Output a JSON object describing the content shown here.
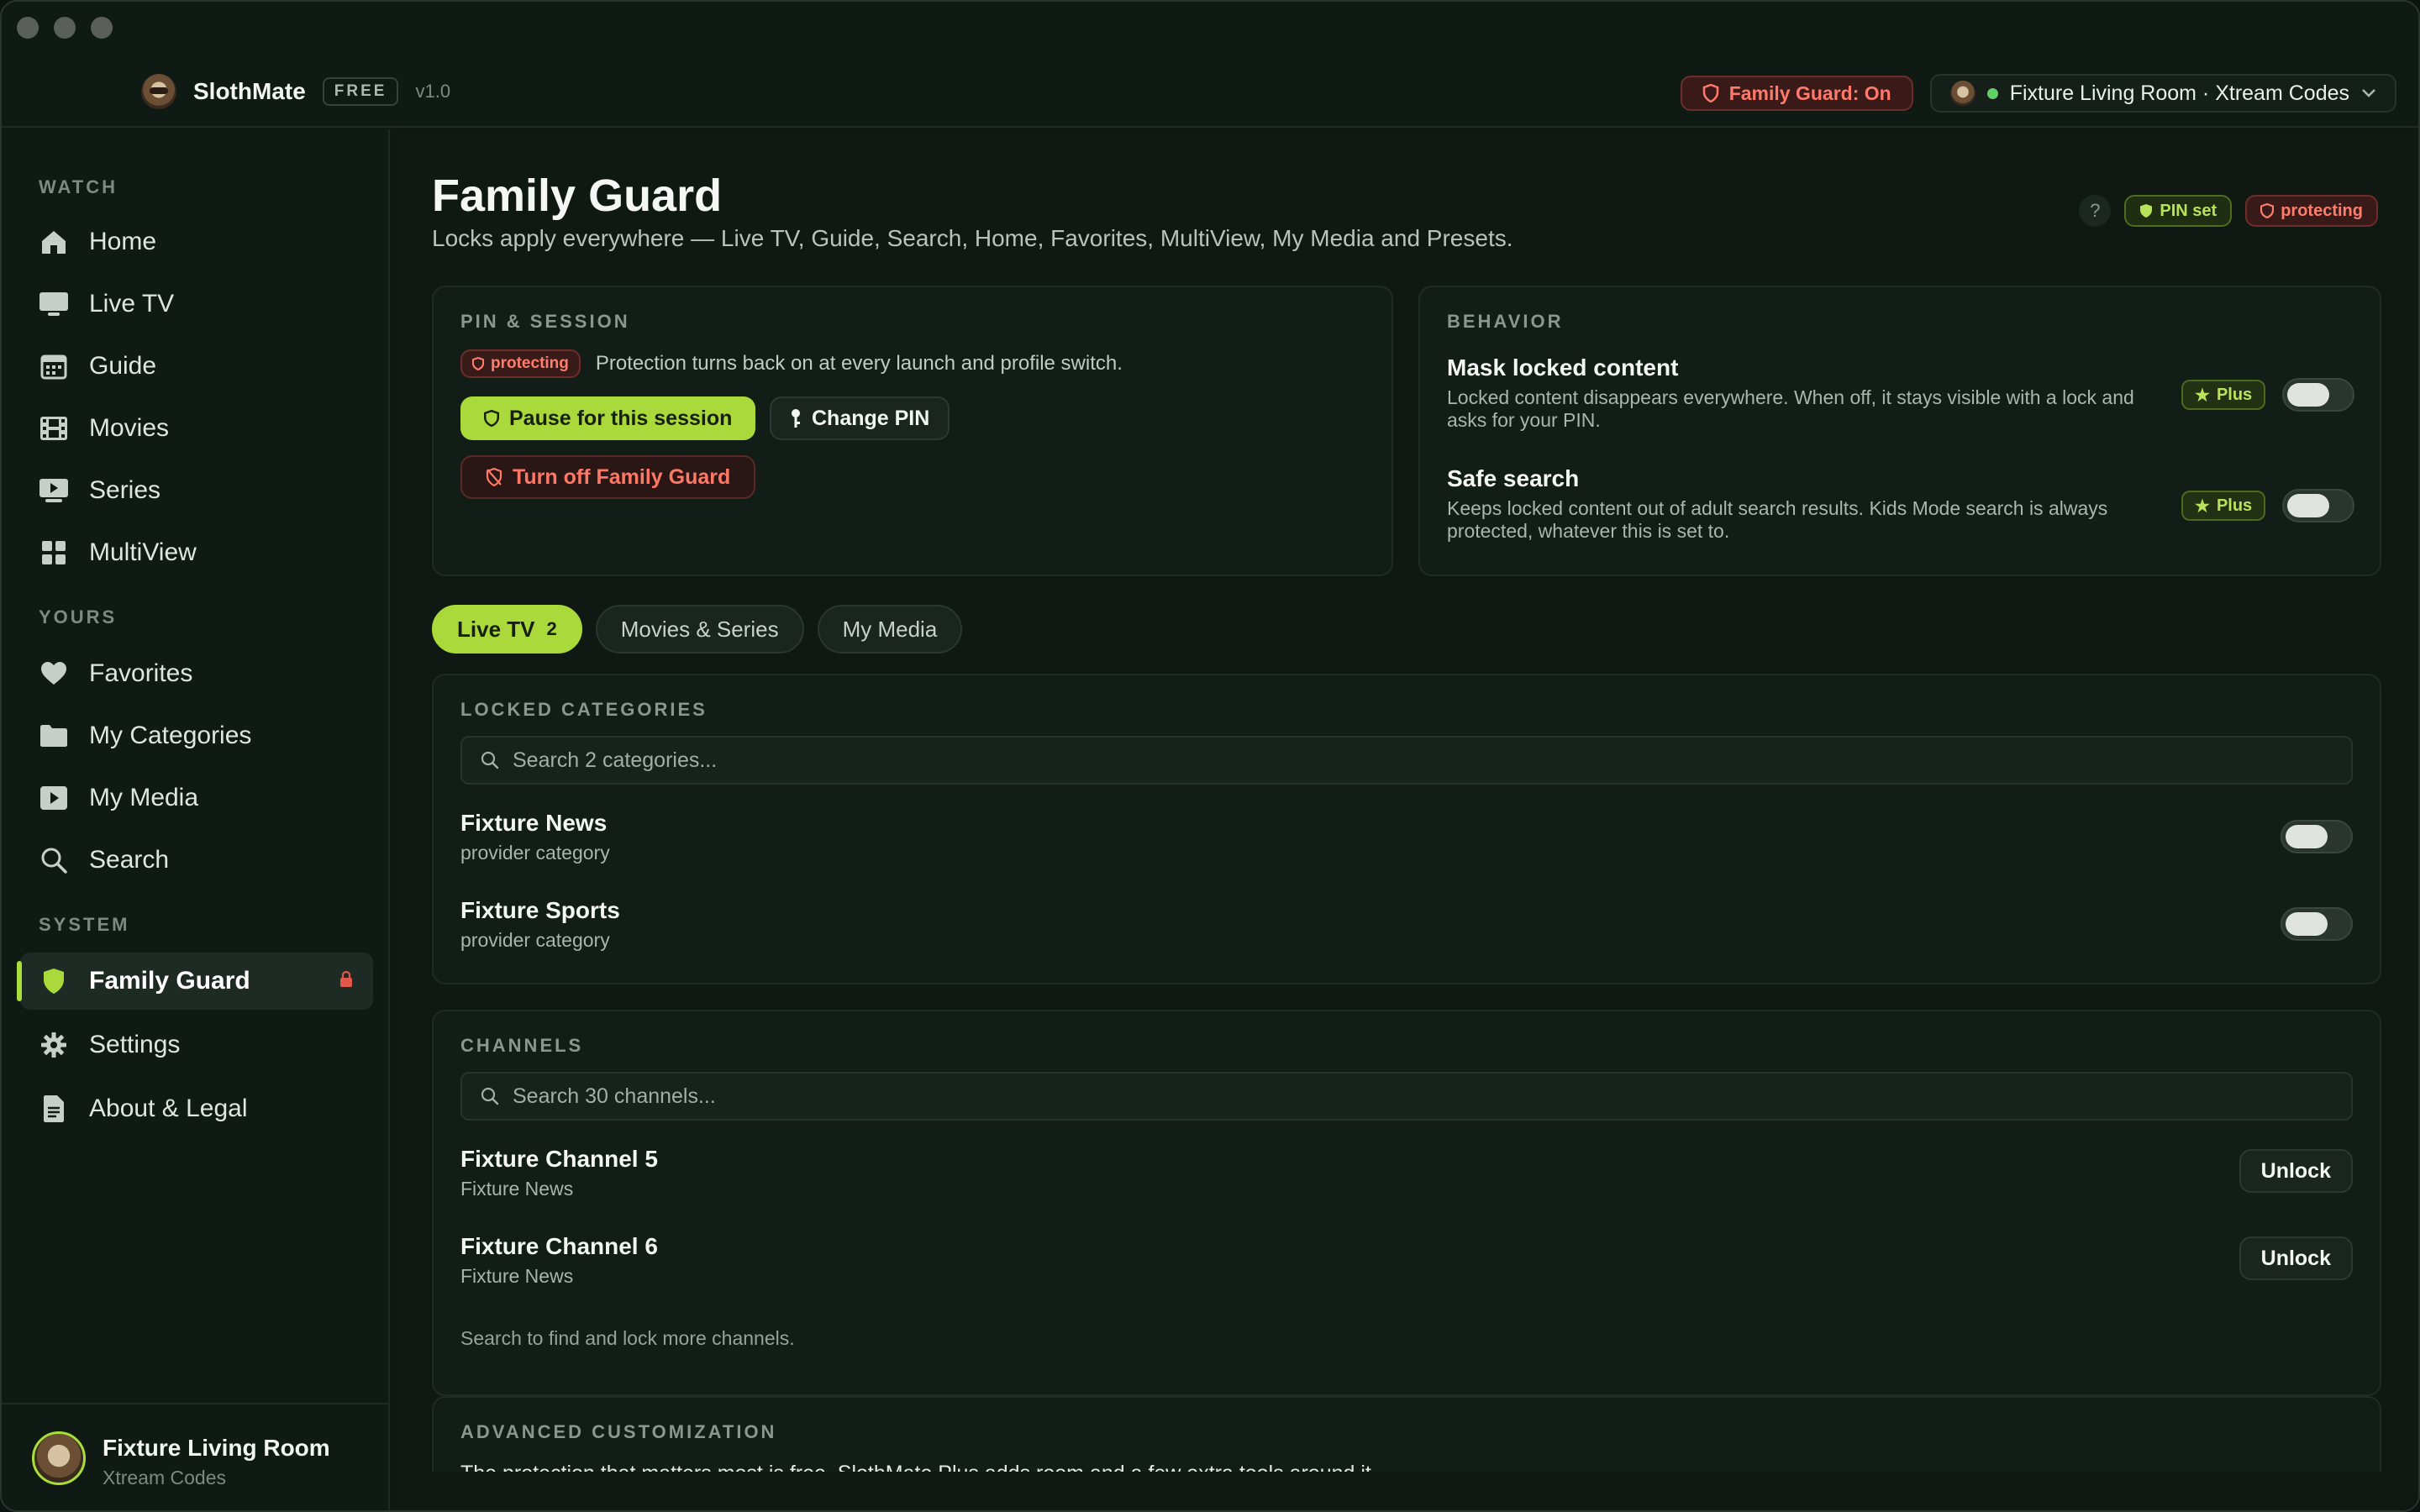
{
  "app": {
    "name": "SlothMate",
    "tier": "FREE",
    "version": "v1.0",
    "family_guard_status": "Family Guard: On",
    "profile_selector": "Fixture Living Room · Xtream Codes"
  },
  "sidebar": {
    "sections": {
      "watch": "WATCH",
      "yours": "YOURS",
      "system": "SYSTEM"
    },
    "watch_items": [
      {
        "label": "Home",
        "icon": "home-icon"
      },
      {
        "label": "Live TV",
        "icon": "tv-icon"
      },
      {
        "label": "Guide",
        "icon": "calendar-icon"
      },
      {
        "label": "Movies",
        "icon": "film-icon"
      },
      {
        "label": "Series",
        "icon": "play-screen-icon"
      },
      {
        "label": "MultiView",
        "icon": "grid-icon"
      }
    ],
    "yours_items": [
      {
        "label": "Favorites",
        "icon": "heart-icon"
      },
      {
        "label": "My Categories",
        "icon": "folder-icon"
      },
      {
        "label": "My Media",
        "icon": "play-icon"
      },
      {
        "label": "Search",
        "icon": "search-icon"
      }
    ],
    "system_items": [
      {
        "label": "Family Guard",
        "icon": "shield-icon",
        "active": true
      },
      {
        "label": "Settings",
        "icon": "gear-icon"
      },
      {
        "label": "About & Legal",
        "icon": "document-icon"
      }
    ],
    "footer": {
      "name": "Fixture Living Room",
      "sub": "Xtream Codes"
    }
  },
  "page": {
    "title": "Family Guard",
    "subtitle": "Locks apply everywhere — Live TV, Guide, Search, Home, Favorites, MultiView, My Media and Presets.",
    "help": "?",
    "badges": {
      "pin": "PIN set",
      "protecting": "protecting"
    }
  },
  "pin_session": {
    "title": "PIN & SESSION",
    "status_badge": "protecting",
    "status_text": "Protection turns back on at every launch and profile switch.",
    "pause_label": "Pause for this session",
    "change_pin_label": "Change PIN",
    "turn_off_label": "Turn off Family Guard"
  },
  "behavior": {
    "title": "BEHAVIOR",
    "items": [
      {
        "title": "Mask locked content",
        "desc": "Locked content disappears everywhere. When off, it stays visible with a lock and asks for your PIN.",
        "badge": "Plus",
        "enabled": false
      },
      {
        "title": "Safe search",
        "desc": "Keeps locked content out of adult search results. Kids Mode search is always protected, whatever this is set to.",
        "badge": "Plus",
        "enabled": false
      }
    ]
  },
  "tabs": [
    {
      "label": "Live TV",
      "count": "2",
      "active": true
    },
    {
      "label": "Movies & Series",
      "count": "",
      "active": false
    },
    {
      "label": "My Media",
      "count": "",
      "active": false
    }
  ],
  "locked_categories": {
    "title": "LOCKED CATEGORIES",
    "search_placeholder": "Search 2 categories...",
    "items": [
      {
        "title": "Fixture News",
        "sub": "provider category",
        "enabled": false
      },
      {
        "title": "Fixture Sports",
        "sub": "provider category",
        "enabled": false
      }
    ]
  },
  "channels": {
    "title": "CHANNELS",
    "search_placeholder": "Search 30 channels...",
    "unlock_label": "Unlock",
    "items": [
      {
        "title": "Fixture Channel 5",
        "sub": "Fixture News"
      },
      {
        "title": "Fixture Channel 6",
        "sub": "Fixture News"
      }
    ],
    "hint": "Search to find and lock more channels."
  },
  "advanced": {
    "title": "ADVANCED CUSTOMIZATION",
    "text": "The protection that matters most is free. SlothMate Plus adds room and a few extra tools around it."
  },
  "colors": {
    "accent": "#a9d93b",
    "danger": "#ff7866",
    "background": "#0f1813"
  }
}
